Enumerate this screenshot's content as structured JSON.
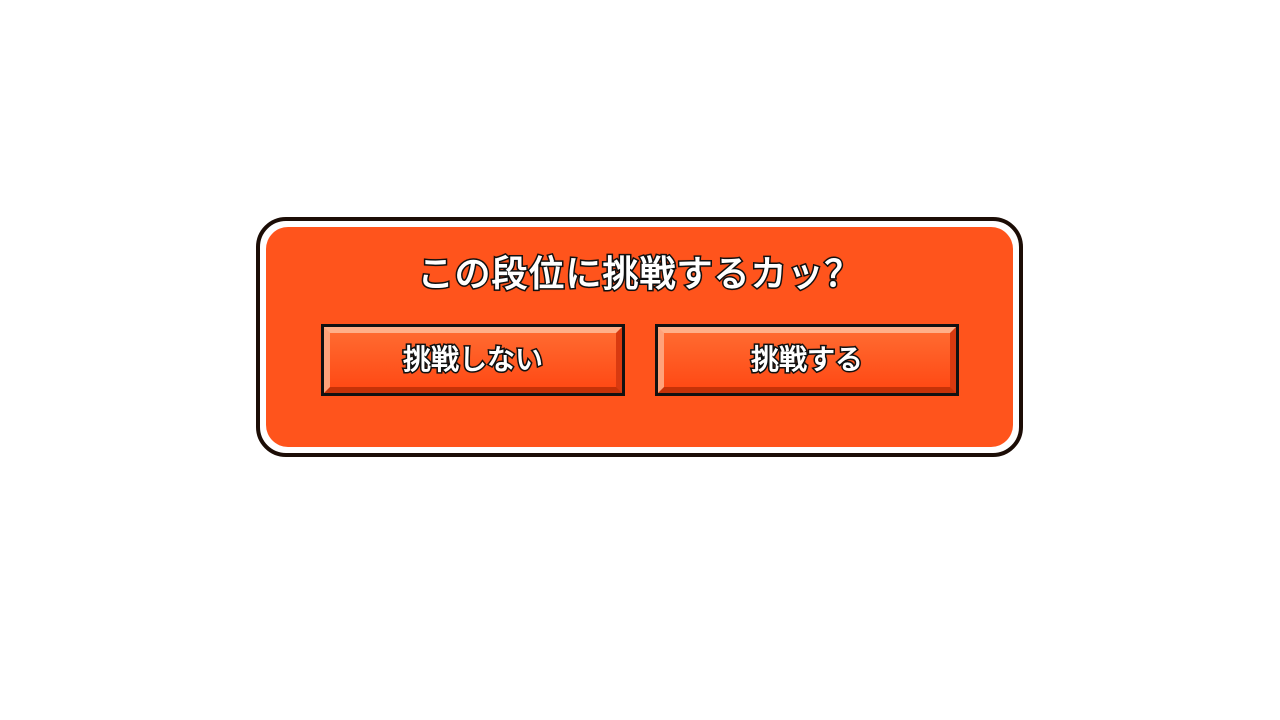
{
  "dialog": {
    "title": "この段位に挑戦するカッ？",
    "buttons": {
      "decline_label": "挑戦しない",
      "accept_label": "挑戦する"
    }
  },
  "colors": {
    "panel": "#ff541c",
    "border": "#1c0d06",
    "button": "#ff5a1f"
  }
}
